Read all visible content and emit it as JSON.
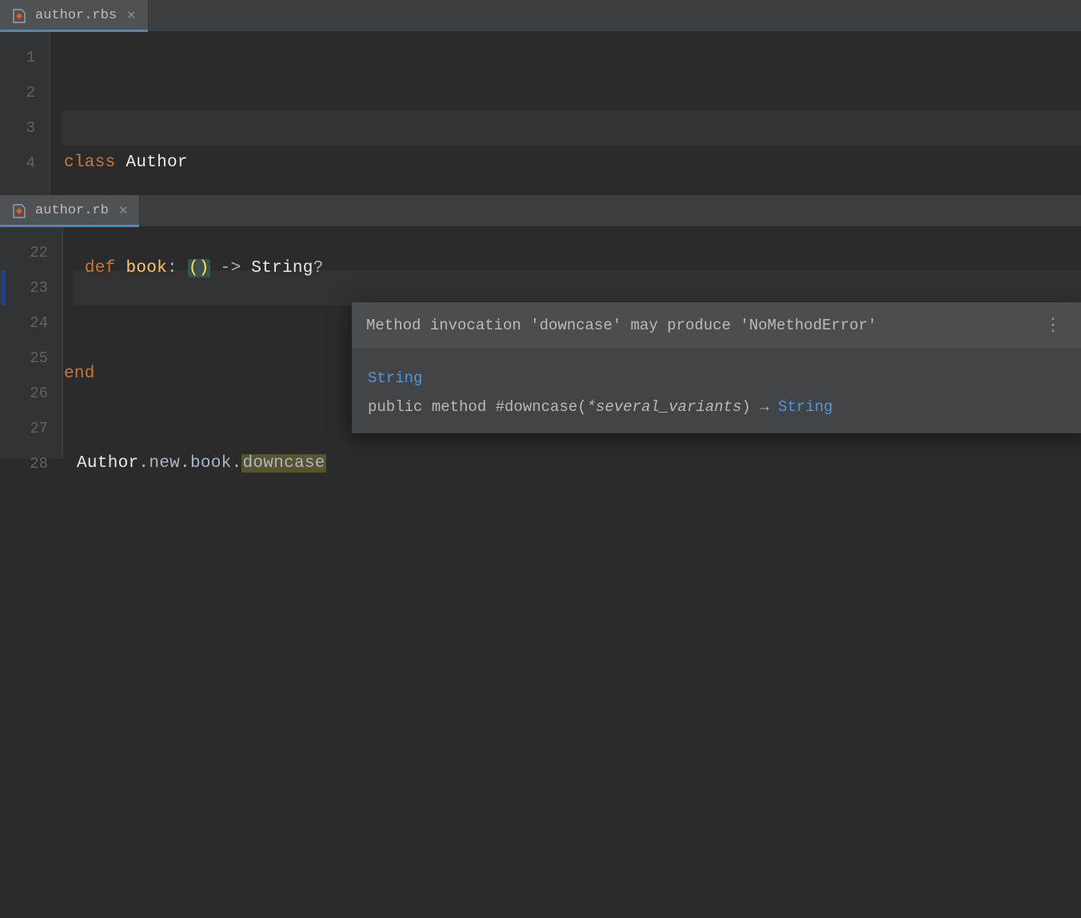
{
  "pane_top": {
    "tab": {
      "filename": "author.rbs"
    },
    "lines": [
      "1",
      "2",
      "3",
      "4"
    ],
    "code": {
      "class_kw": "class",
      "class_name": "Author",
      "def_kw": "def",
      "method_name": "book",
      "colon": ":",
      "parens": "()",
      "arrow": "->",
      "return_type": "String",
      "qmark": "?",
      "end_kw": "end"
    }
  },
  "pane_bottom": {
    "tab": {
      "filename": "author.rb"
    },
    "lines": [
      "22",
      "23",
      "24",
      "25",
      "26",
      "27",
      "28"
    ],
    "code": {
      "receiver": "Author",
      "dot1": ".",
      "new": "new",
      "dot2": ".",
      "book": "book",
      "dot3": ".",
      "downcase": "downcase"
    }
  },
  "tooltip": {
    "message": "Method invocation 'downcase' may produce 'NoMethodError'",
    "type_link": "String",
    "sig_prefix": "public method #downcase(",
    "sig_args": "*several_variants",
    "sig_suffix": ") →",
    "sig_ret": "String"
  },
  "colors": {
    "keyword": "#cc7832",
    "method": "#ffc66d",
    "link": "#5494d8"
  }
}
